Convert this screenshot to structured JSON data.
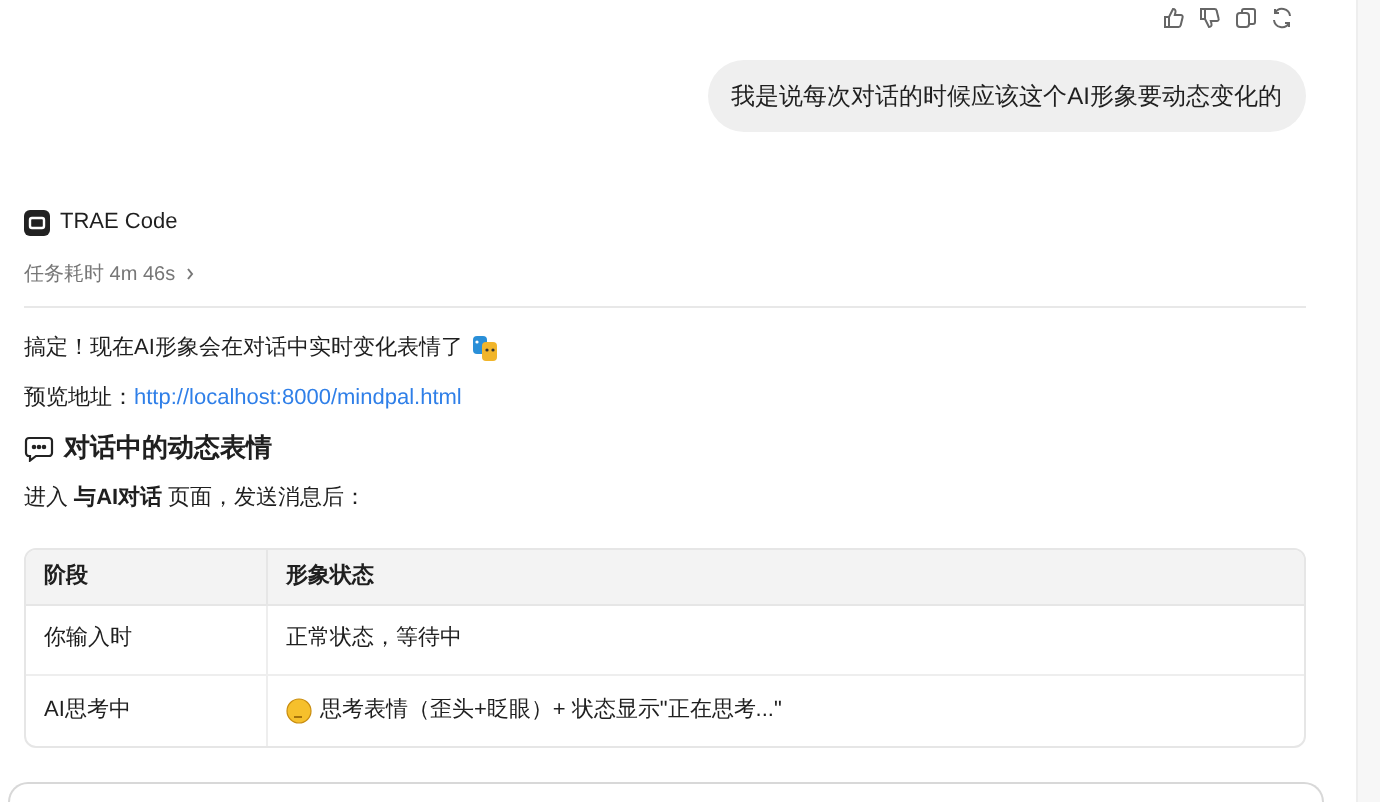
{
  "user_message": {
    "text": "我是说每次对话的时候应该这个AI形象要动态变化的"
  },
  "assistant": {
    "name": "TRAE Code",
    "duration": "任务耗时 4m 46s",
    "lines": [
      {
        "kind": "emoji_text",
        "text": "搞定！现在AI形象会在对话中实时变化表情了"
      },
      {
        "kind": "link",
        "text": "预览地址：",
        "link": "http://localhost:8000/mindpal.html"
      },
      {
        "kind": "heading",
        "text": "对话中的动态表情"
      },
      {
        "kind": "text",
        "text": "进入 **与AI对话** 页面，发送消息后："
      }
    ],
    "table": {
      "columns": [
        "阶段",
        "形象状态"
      ],
      "rows": [
        {
          "kind": "plain",
          "cells": [
            "你输入时",
            "正常状态，等待中"
          ]
        },
        {
          "kind": "emoji",
          "cells": [
            "AI思考中",
            "思考表情（歪头+眨眼）+ 状态显示\"正在思考...\""
          ]
        }
      ]
    }
  }
}
